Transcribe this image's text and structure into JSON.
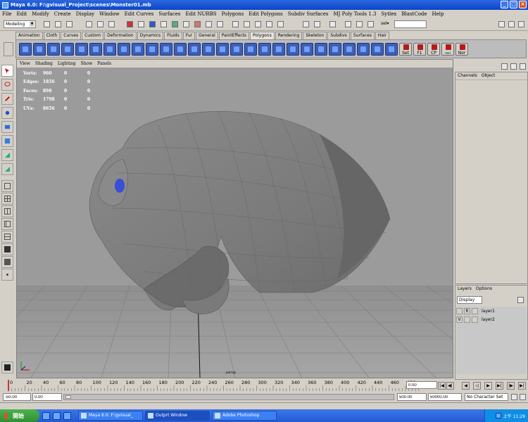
{
  "window": {
    "title": "Maya 6.0: F:\\gvisual_Project\\scenes\\Monster01.mb",
    "minimize": "_",
    "maximize": "□",
    "close": "×"
  },
  "menubar": [
    "File",
    "Edit",
    "Modify",
    "Create",
    "Display",
    "Window",
    "Edit Curves",
    "Surfaces",
    "Edit NURBS",
    "Polygons",
    "Edit Polygons",
    "Subdiv Surfaces",
    "MJ Poly Tools 1.3",
    "Sytlex",
    "BlastCode",
    "Help"
  ],
  "statusline": {
    "mode": "Modeling",
    "sel_label": "sel▾",
    "sel_value": ""
  },
  "shelf": {
    "tabs": [
      "Animation",
      "Cloth",
      "Curves",
      "Custom",
      "Deformation",
      "Dynamics",
      "Fluids",
      "Fur",
      "General",
      "PaintEffects",
      "Polygons",
      "Rendering",
      "Skeleton",
      "Subdivs",
      "Surfaces",
      "Hair"
    ],
    "active_tab": "Polygons",
    "labeled_buttons": [
      "Set",
      "F1",
      "CP",
      "mel button",
      "Nor"
    ]
  },
  "viewport": {
    "menu": [
      "View",
      "Shading",
      "Lighting",
      "Show",
      "Panels"
    ],
    "hud": [
      {
        "label": "Verts:",
        "a": "960",
        "b": "0",
        "c": "0"
      },
      {
        "label": "Edges:",
        "a": "1856",
        "b": "0",
        "c": "0"
      },
      {
        "label": "Faces:",
        "a": "898",
        "b": "0",
        "c": "0"
      },
      {
        "label": "Tris:",
        "a": "1798",
        "b": "0",
        "c": "0"
      },
      {
        "label": "UVs:",
        "a": "8656",
        "b": "0",
        "c": "0"
      }
    ],
    "camera": "persp"
  },
  "channel_box": {
    "menu": [
      "Channels",
      "Object"
    ]
  },
  "layers": {
    "menu": [
      "Layers",
      "Options"
    ],
    "display_option": "Display",
    "rows": [
      {
        "vis": "",
        "type": "R",
        "name": "layer1"
      },
      {
        "vis": "V",
        "type": "",
        "name": "layer2"
      }
    ]
  },
  "time": {
    "ticks": [
      "0",
      "20",
      "40",
      "60",
      "80",
      "100",
      "120",
      "140",
      "160",
      "180",
      "200",
      "220",
      "240",
      "260",
      "280",
      "300",
      "320",
      "340",
      "360",
      "380",
      "400",
      "420",
      "440",
      "460",
      "480",
      "5"
    ],
    "current": "0.00",
    "range_start": "-50.00",
    "playback_start": "0.00",
    "playback_end": "500.00",
    "range_end": "50000.00",
    "character_set": "No Character Set"
  },
  "taskbar": {
    "start": "開始",
    "tasks": [
      {
        "label": "Maya 6.0: F:\\gvisual_",
        "active": false
      },
      {
        "label": "Outprt Window",
        "active": true
      },
      {
        "label": "Adobe Photoshop",
        "active": false
      }
    ],
    "clock": "上午 11:29"
  },
  "colors": {
    "viewport_bg": "#9b9b9b",
    "mesh": "#7c7c7c",
    "eye": "#3a4ed6",
    "selection_red": "#b21b1b",
    "taskbar": "#245bd4"
  }
}
